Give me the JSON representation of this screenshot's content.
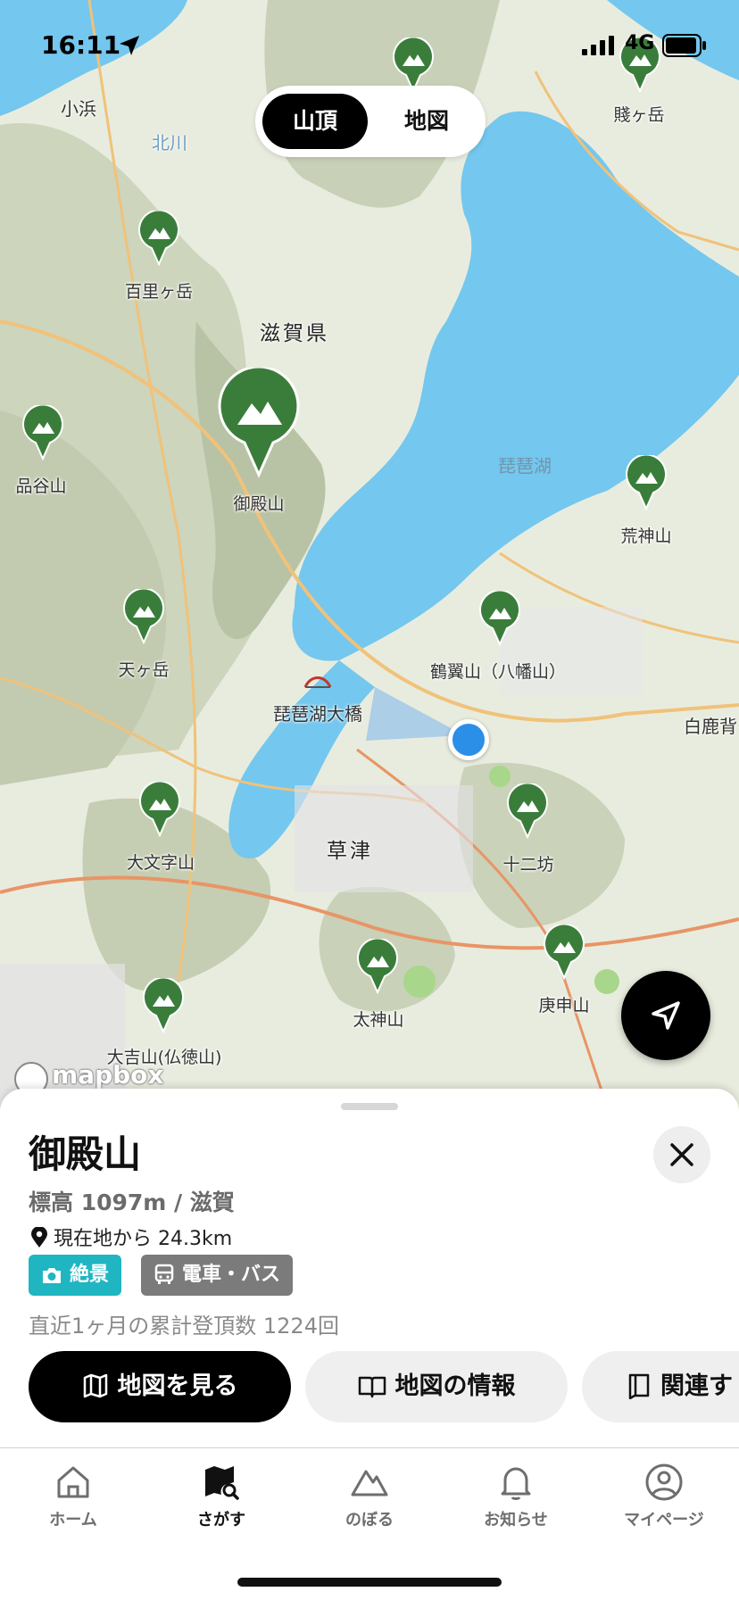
{
  "status_bar": {
    "time": "16:11",
    "network": "4G"
  },
  "segment": {
    "options": [
      "山頂",
      "地図"
    ],
    "selected": "山頂"
  },
  "map": {
    "place_labels": {
      "obama": "小浜",
      "kitagawa": "北川",
      "shiga": "滋賀県",
      "biwako": "琵琶湖",
      "bridge": "琵琶湖大橋",
      "kusatsu": "草津",
      "shirakashi": "白鹿背"
    },
    "peaks": [
      {
        "name": ""
      },
      {
        "name": "賤ヶ岳"
      },
      {
        "name": "百里ヶ岳"
      },
      {
        "name": "御殿山"
      },
      {
        "name": "品谷山"
      },
      {
        "name": "荒神山"
      },
      {
        "name": "天ヶ岳"
      },
      {
        "name": "鶴翼山（八幡山）"
      },
      {
        "name": "大文字山"
      },
      {
        "name": "十二坊"
      },
      {
        "name": "太神山"
      },
      {
        "name": "庚申山"
      },
      {
        "name": "大吉山(仏徳山)"
      }
    ],
    "attribution": "mapbox"
  },
  "detail": {
    "title": "御殿山",
    "elevation": "標高 1097m / 滋賀",
    "distance": "現在地から 24.3km",
    "tags": {
      "scenic": "絶景",
      "transit": "電車・バス"
    },
    "stats": "直近1ヶ月の累計登頂数 1224回",
    "buttons": {
      "view_map": "地図を見る",
      "map_info": "地図の情報",
      "related": "関連す"
    }
  },
  "tabs": [
    {
      "label": "ホーム",
      "icon": "home-icon"
    },
    {
      "label": "さがす",
      "icon": "map-search-icon",
      "active": true
    },
    {
      "label": "のぼる",
      "icon": "mountain-icon"
    },
    {
      "label": "お知らせ",
      "icon": "bell-icon"
    },
    {
      "label": "マイページ",
      "icon": "person-icon"
    }
  ],
  "colors": {
    "pin_green": "#3a7d3b",
    "lake": "#74c7ee",
    "accent_teal": "#1fb6c2",
    "user_location": "#2b8fe8"
  }
}
